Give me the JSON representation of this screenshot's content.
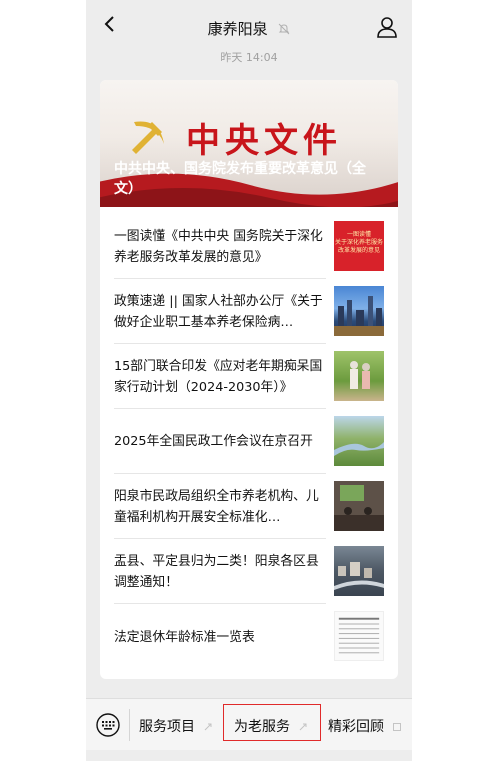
{
  "header": {
    "title": "康养阳泉",
    "back_icon": "chevron-left-icon",
    "mute_icon": "mute-bell-icon",
    "profile_icon": "user-icon"
  },
  "timestamp": "昨天 14:04",
  "article_card": {
    "hero": {
      "banner_text": "中央文件",
      "headline": "中共中央、国务院发布重要改革意见（全文）"
    },
    "items": [
      {
        "title": "一图读懂《中共中央 国务院关于深化养老服务改革发展的意见》",
        "thumb_text": "一图读懂\n关于深化养老服务\n改革发展的意见"
      },
      {
        "title": "政策速递 || 国家人社部办公厅《关于做好企业职工基本养老保险病…"
      },
      {
        "title": "15部门联合印发《应对老年期痴呆国家行动计划（2024-2030年）》"
      },
      {
        "title": "2025年全国民政工作会议在京召开"
      },
      {
        "title": "阳泉市民政局组织全市养老机构、儿童福利机构开展安全标准化…"
      },
      {
        "title": "盂县、平定县归为二类！阳泉各区县调整通知！"
      },
      {
        "title": "法定退休年龄标准一览表"
      }
    ]
  },
  "bottom_menu": {
    "keyboard_icon": "keyboard-icon",
    "items": [
      {
        "label": "服务项目",
        "icon": "submenu-icon"
      },
      {
        "label": "为老服务",
        "icon": "submenu-icon"
      },
      {
        "label": "精彩回顾",
        "icon": "submenu-icon"
      }
    ],
    "highlight_color": "#e02a2a"
  },
  "colors": {
    "accent_red": "#c8151b",
    "background": "#ededed"
  }
}
